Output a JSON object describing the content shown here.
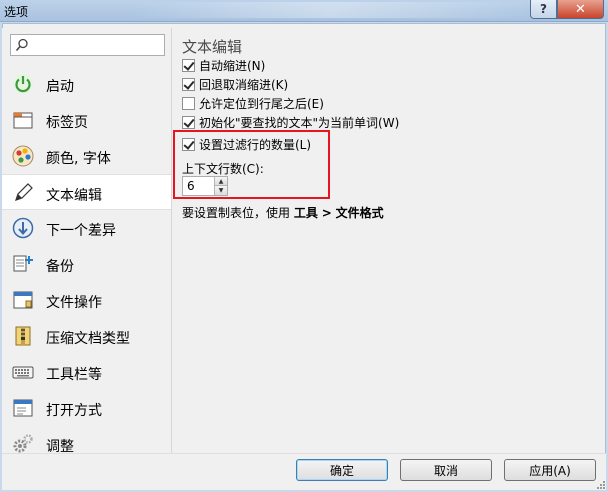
{
  "window": {
    "title": "选项"
  },
  "search": {
    "placeholder": ""
  },
  "sidebar": {
    "items": [
      {
        "label": "启动",
        "icon": "power-icon"
      },
      {
        "label": "标签页",
        "icon": "tabs-icon"
      },
      {
        "label": "颜色, 字体",
        "icon": "palette-icon"
      },
      {
        "label": "文本编辑",
        "icon": "pen-icon",
        "selected": true
      },
      {
        "label": "下一个差异",
        "icon": "next-diff-icon"
      },
      {
        "label": "备份",
        "icon": "backup-icon"
      },
      {
        "label": "文件操作",
        "icon": "file-ops-icon"
      },
      {
        "label": "压缩文档类型",
        "icon": "archive-icon"
      },
      {
        "label": "工具栏等",
        "icon": "keyboard-icon"
      },
      {
        "label": "打开方式",
        "icon": "open-with-icon"
      },
      {
        "label": "调整",
        "icon": "gears-icon"
      }
    ]
  },
  "content": {
    "section_title": "文本编辑",
    "options": [
      {
        "label": "自动缩进(N)",
        "checked": true
      },
      {
        "label": "回退取消缩进(K)",
        "checked": true
      },
      {
        "label": "允许定位到行尾之后(E)",
        "checked": false
      },
      {
        "label": "初始化\"要查找的文本\"为当前单词(W)",
        "checked": true
      },
      {
        "label": "设置过滤行的数量(L)",
        "checked": true
      }
    ],
    "context_lines_label": "上下文行数(C):",
    "context_lines_value": "6",
    "hint_prefix": "要设置制表位，使用",
    "hint_tools": "工具",
    "hint_sep": ">",
    "hint_format": "文件格式"
  },
  "buttons": {
    "ok": "确定",
    "cancel": "取消",
    "apply": "应用(A)"
  },
  "colors": {
    "highlight_box": "#e8141f",
    "titlebar": "#bcd2ea",
    "close_button": "#c9442a"
  }
}
